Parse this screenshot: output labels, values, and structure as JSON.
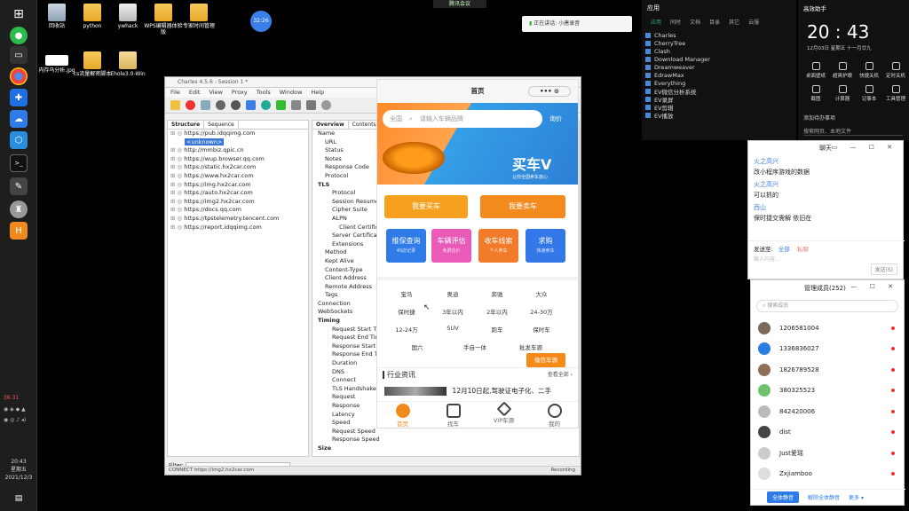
{
  "meeting_bar": "腾讯会议",
  "desktop": {
    "icons": [
      {
        "label": "回收站"
      },
      {
        "label": "python"
      },
      {
        "label": "ywhack"
      },
      {
        "label": "WPS编辑器体验版"
      },
      {
        "label": "专家时间管理"
      },
      {
        "label": "内存马分析.jpg"
      },
      {
        "label": "cs流量解密脚本"
      },
      {
        "label": "Ehole3.0-Win"
      }
    ],
    "recording_time": "32:26",
    "voice_label": "正在讲话: 小唐录音"
  },
  "taskbar": {
    "time": "20:43",
    "weekday": "星期五",
    "date": "2021/12/3",
    "tray_numbers": [
      "36",
      "31"
    ]
  },
  "charles": {
    "title": "Charles 4.5.6 - Session 1 *",
    "menu": [
      "File",
      "Edit",
      "View",
      "Proxy",
      "Tools",
      "Window",
      "Help"
    ],
    "left_tabs": [
      "Structure",
      "Sequence"
    ],
    "tree": [
      {
        "text": "https://pub.idqqimg.com",
        "selected": false
      },
      {
        "text": "<unknown>",
        "selected": true
      },
      {
        "text": "http://mmbiz.qpic.cn",
        "selected": false
      },
      {
        "text": "https://wup.browser.qq.com",
        "selected": false
      },
      {
        "text": "https://static.hx2car.com",
        "selected": false
      },
      {
        "text": "https://www.hx2car.com",
        "selected": false
      },
      {
        "text": "https://img.hx2car.com",
        "selected": false
      },
      {
        "text": "https://auto.hx2car.com",
        "selected": false
      },
      {
        "text": "https://img2.hx2car.com",
        "selected": false
      },
      {
        "text": "https://docs.qq.com",
        "selected": false
      },
      {
        "text": "https://tpstelemetry.tencent.com",
        "selected": false
      },
      {
        "text": "https://report.idqqimg.com",
        "selected": false
      }
    ],
    "right_tabs": [
      "Overview",
      "Contents",
      "Su"
    ],
    "props": [
      {
        "text": "Name",
        "bold": false,
        "indent": 0
      },
      {
        "text": "URL",
        "bold": false,
        "indent": 1
      },
      {
        "text": "Status",
        "bold": false,
        "indent": 1
      },
      {
        "text": "Notes",
        "bold": false,
        "indent": 1
      },
      {
        "text": "Response Code",
        "bold": false,
        "indent": 1
      },
      {
        "text": "Protocol",
        "bold": false,
        "indent": 1
      },
      {
        "text": "TLS",
        "bold": true,
        "indent": 0
      },
      {
        "text": "Protocol",
        "bold": false,
        "indent": 2
      },
      {
        "text": "Session Resumed",
        "bold": false,
        "indent": 2
      },
      {
        "text": "Cipher Suite",
        "bold": false,
        "indent": 2
      },
      {
        "text": "ALPN",
        "bold": false,
        "indent": 2
      },
      {
        "text": "Client Certificates",
        "bold": false,
        "indent": 3
      },
      {
        "text": "Server Certificates",
        "bold": false,
        "indent": 2
      },
      {
        "text": "Extensions",
        "bold": false,
        "indent": 2
      },
      {
        "text": "Method",
        "bold": false,
        "indent": 1
      },
      {
        "text": "Kept Alive",
        "bold": false,
        "indent": 1
      },
      {
        "text": "Content-Type",
        "bold": false,
        "indent": 1
      },
      {
        "text": "Client Address",
        "bold": false,
        "indent": 1
      },
      {
        "text": "Remote Address",
        "bold": false,
        "indent": 1
      },
      {
        "text": "Tags",
        "bold": false,
        "indent": 1
      },
      {
        "text": "Connection",
        "bold": false,
        "indent": 0
      },
      {
        "text": "WebSockets",
        "bold": false,
        "indent": 0
      },
      {
        "text": "Timing",
        "bold": true,
        "indent": 0
      },
      {
        "text": "Request Start Time",
        "bold": false,
        "indent": 2
      },
      {
        "text": "Request End Time",
        "bold": false,
        "indent": 2
      },
      {
        "text": "Response Start Time",
        "bold": false,
        "indent": 2
      },
      {
        "text": "Response End Time",
        "bold": false,
        "indent": 2
      },
      {
        "text": "Duration",
        "bold": false,
        "indent": 2
      },
      {
        "text": "DNS",
        "bold": false,
        "indent": 2
      },
      {
        "text": "Connect",
        "bold": false,
        "indent": 2
      },
      {
        "text": "TLS Handshake",
        "bold": false,
        "indent": 2
      },
      {
        "text": "Request",
        "bold": false,
        "indent": 2
      },
      {
        "text": "Response",
        "bold": false,
        "indent": 2
      },
      {
        "text": "Latency",
        "bold": false,
        "indent": 2
      },
      {
        "text": "Speed",
        "bold": false,
        "indent": 2
      },
      {
        "text": "Request Speed",
        "bold": false,
        "indent": 2
      },
      {
        "text": "Response Speed",
        "bold": false,
        "indent": 2
      },
      {
        "text": "Size",
        "bold": true,
        "indent": 0
      }
    ],
    "filter_label": "Filter:",
    "status_left": "CONNECT https://img2.hx2car.com",
    "status_right": "Recording"
  },
  "phone": {
    "page_title": "首页",
    "capsule": "••• ⊙",
    "city": "全国",
    "search_placeholder": "请输入车辆品牌",
    "search_button": "询价",
    "slogan": "买车V",
    "sub_slogan": "让你全国卖车放心",
    "buy_button": "我要买车",
    "sell_button": "我要卖车",
    "services": [
      {
        "title": "维保查询",
        "sub": "4S店记录",
        "color": "#2f7be8"
      },
      {
        "title": "车辆评估",
        "sub": "免费估价",
        "color": "#e95ab9"
      },
      {
        "title": "收车线索",
        "sub": "个人卖车",
        "color": "#f27b2a"
      },
      {
        "title": "求购",
        "sub": "快速卖车",
        "color": "#3477e9"
      }
    ],
    "brands_row1": [
      "宝马",
      "奥迪",
      "奔驰",
      "大众"
    ],
    "brands_row2": [
      "保时捷",
      "3年以内",
      "2年以内",
      "24-30万"
    ],
    "brands_row3": [
      "12-24万",
      "SUV",
      "跑车",
      "保时车"
    ],
    "brands_row4": [
      "国六",
      "手自一体",
      "批发车源"
    ],
    "promo": "微信车源",
    "news_title": "行业资讯",
    "news_more": "查看全部 ›",
    "news_item": "12月10日起,驾驶证电子化、二手",
    "tabs": [
      "首页",
      "找车",
      "VIP车源",
      "我的"
    ]
  },
  "apps_panel": {
    "tabs": [
      "应用",
      "同时",
      "文档",
      "目录",
      "其它",
      "云服"
    ],
    "items": [
      "Charles",
      "CherryTree",
      "Clash",
      "Download Manager",
      "Dreamweaver",
      "EdrawMax",
      "Everything",
      "EV微信分析系统",
      "EV录屏",
      "EV剪辑",
      "EV播放"
    ]
  },
  "clock_panel": {
    "title": "高效助手",
    "time": "20 : 43",
    "date_line": "12月03日   星期五   十一月廿九",
    "tools_row1": [
      "桌面壁纸",
      "超爽护眼",
      "快捷关机",
      "定时关机"
    ],
    "tools_row2": [
      "截图",
      "计算器",
      "记事本",
      "工具管理"
    ],
    "add_task": "添加待办事项",
    "search": "搜索网页、本地文件"
  },
  "chat": {
    "title": "聊天",
    "messages": [
      {
        "name": "火之高兴",
        "text": "改小程序游戏的数据"
      },
      {
        "name": "火之高兴",
        "text": "可以抓的"
      },
      {
        "name": "西山",
        "text": "保时捷交需解 依旧在"
      }
    ],
    "send_to_label": "发送至:",
    "send_to": "全部",
    "private": "私聊",
    "input_placeholder": "输入内容…",
    "send_button": "发送(S)"
  },
  "members": {
    "title": "管理成员(252)",
    "search_placeholder": "搜索成员",
    "list": [
      {
        "name": "1206581004",
        "color": "#7b6a5a"
      },
      {
        "name": "1336836027",
        "color": "#2b7de0"
      },
      {
        "name": "1826789528",
        "color": "#8e6f5a"
      },
      {
        "name": "380325523",
        "color": "#6cc36c"
      },
      {
        "name": "842420006",
        "color": "#bbbbbb"
      },
      {
        "name": "dist",
        "color": "#444444"
      },
      {
        "name": "Just爱瑶",
        "color": "#cccccc"
      },
      {
        "name": "Zxjiamboo",
        "color": "#dddddd"
      }
    ],
    "btn_mute_all": "全体静音",
    "btn_unmute_all": "解除全体静音",
    "btn_more": "更多 ▾"
  }
}
